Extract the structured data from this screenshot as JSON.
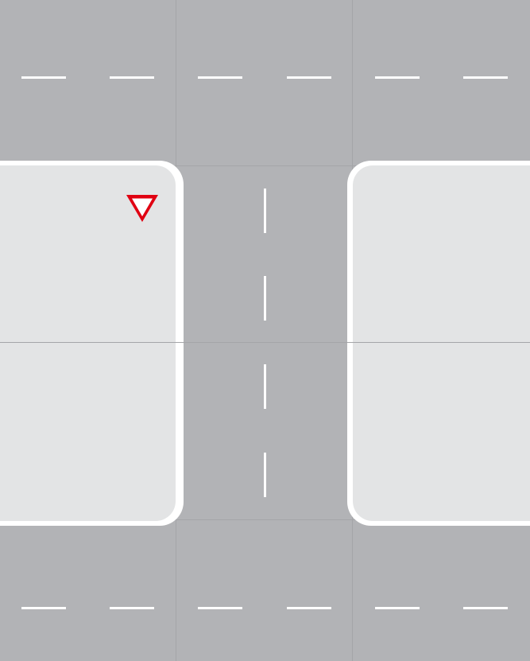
{
  "map": {
    "colors": {
      "road": "#b2b3b6",
      "block": "#e3e4e5",
      "curb": "#ffffff",
      "lane_marking": "#ffffff",
      "grid_line": "#a4a5a8",
      "yield_sign": "#e00012"
    },
    "elements": {
      "roads": [
        "upper-horizontal-road",
        "lower-horizontal-road",
        "center-vertical-road"
      ],
      "blocks": [
        "left-city-block",
        "right-city-block"
      ],
      "signs": [
        {
          "icon": "yield-sign-icon",
          "type": "yield"
        }
      ]
    }
  }
}
